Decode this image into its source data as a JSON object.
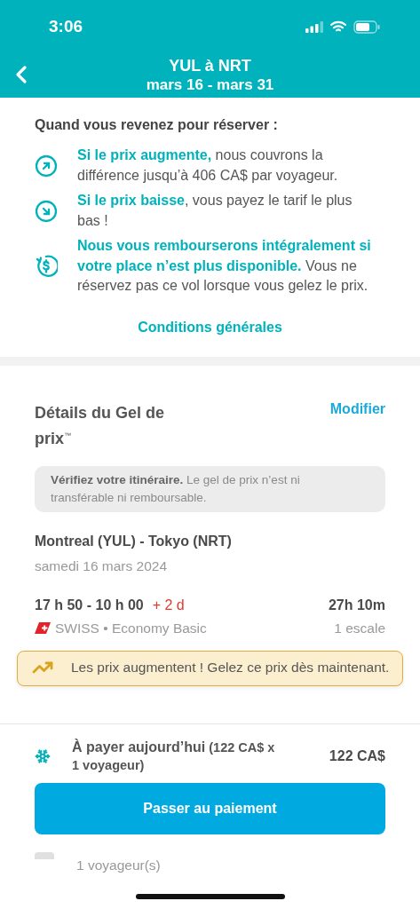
{
  "status_bar": {
    "time": "3:06"
  },
  "header": {
    "title": "YUL à NRT",
    "subtitle": "mars 16 - mars 31"
  },
  "freeze_info": {
    "heading": "Quand vous revenez pour réserver :",
    "benefits": [
      {
        "kind": "up",
        "text": "**Si le prix augmente,** nous couvrons la différence jusqu’à 406 CA$ par voyageur."
      },
      {
        "kind": "down",
        "text": "**Si le prix baisse**, vous payez le tarif le plus bas !"
      },
      {
        "kind": "refund",
        "text": "**Nous vous rembourserons intégralement si votre place n’est plus disponible.** Vous ne réservez pas ce vol lorsque vous gelez le prix."
      }
    ],
    "terms_link": "Conditions générales"
  },
  "details": {
    "title": "Détails du Gel de prix$^{™}$",
    "edit_link": "Modifier",
    "notice": "**Vérifiez votre itinéraire.** Le gel de prix n’est ni transférable ni remboursable.",
    "route": "Montreal (YUL) - Tokyo (NRT)",
    "date": "samedi 16 mars 2024",
    "times": "17 h 50 - 10 h 00",
    "day_offset": "+ 2 d",
    "duration": "27h 10m",
    "airline": "SWISS • Economy Basic",
    "stops": "1 escale"
  },
  "alert": {
    "text": "Les prix augmentent ! Gelez ce prix dès maintenant."
  },
  "payment": {
    "label": "**À payer aujourd’hui** (122 CA$ x 1 voyageur)",
    "amount": "122 CA$",
    "button": "Passer au paiement"
  },
  "footer": {
    "travelers": "1 voyageur(s)"
  }
}
